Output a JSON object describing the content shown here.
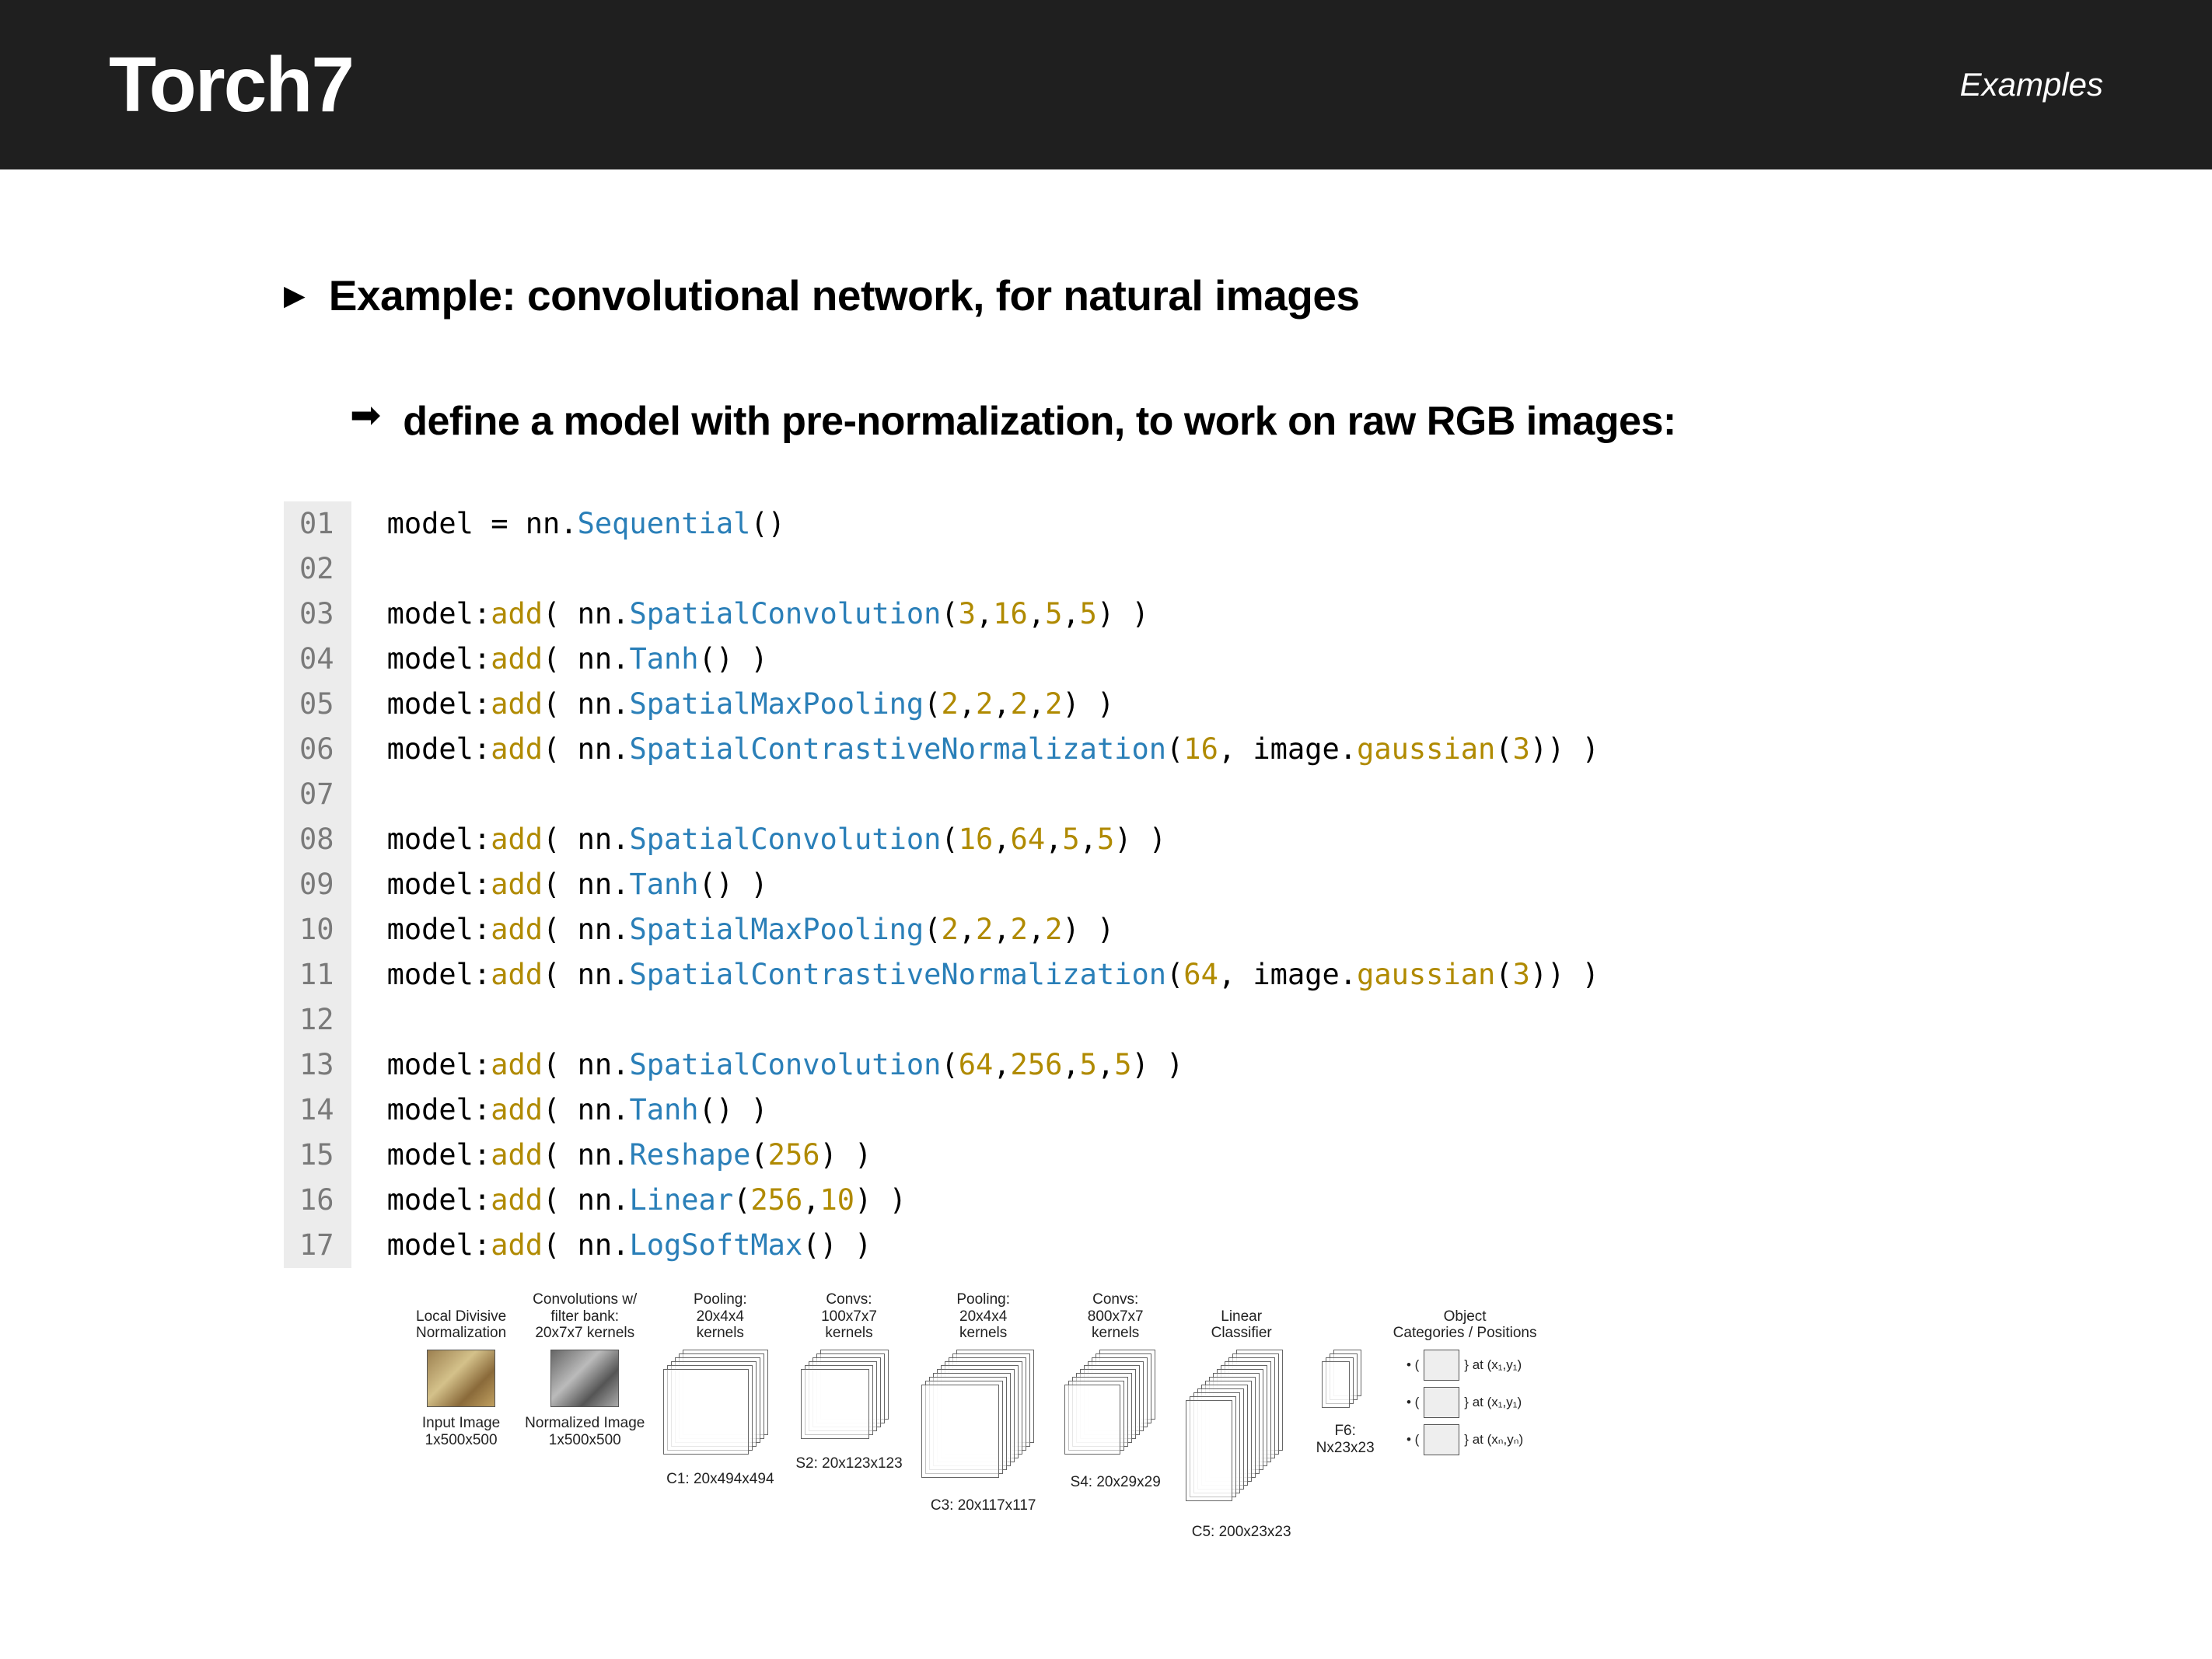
{
  "header": {
    "title": "Torch7",
    "subtitle": "Examples"
  },
  "section": {
    "title": "Example: convolutional network, for natural images",
    "subtitle": "define a model with pre-normalization, to work on raw RGB images:"
  },
  "code": {
    "lines": [
      {
        "n": "01",
        "t": [
          {
            "p": "model "
          },
          {
            "p": "="
          },
          {
            "p": " nn"
          },
          {
            "p": ".",
            "c": ""
          },
          {
            "p": "Sequential",
            "c": "fn"
          },
          {
            "p": "()"
          }
        ]
      },
      {
        "n": "02",
        "t": []
      },
      {
        "n": "03",
        "t": [
          {
            "p": "model"
          },
          {
            "p": ":"
          },
          {
            "p": "add",
            "c": "method"
          },
          {
            "p": "( nn."
          },
          {
            "p": "SpatialConvolution",
            "c": "fn"
          },
          {
            "p": "("
          },
          {
            "p": "3",
            "c": "num"
          },
          {
            "p": ","
          },
          {
            "p": "16",
            "c": "num"
          },
          {
            "p": ","
          },
          {
            "p": "5",
            "c": "num"
          },
          {
            "p": ","
          },
          {
            "p": "5",
            "c": "num"
          },
          {
            "p": ") )"
          }
        ]
      },
      {
        "n": "04",
        "t": [
          {
            "p": "model"
          },
          {
            "p": ":"
          },
          {
            "p": "add",
            "c": "method"
          },
          {
            "p": "( nn."
          },
          {
            "p": "Tanh",
            "c": "fn"
          },
          {
            "p": "() )"
          }
        ]
      },
      {
        "n": "05",
        "t": [
          {
            "p": "model"
          },
          {
            "p": ":"
          },
          {
            "p": "add",
            "c": "method"
          },
          {
            "p": "( nn."
          },
          {
            "p": "SpatialMaxPooling",
            "c": "fn"
          },
          {
            "p": "("
          },
          {
            "p": "2",
            "c": "num"
          },
          {
            "p": ","
          },
          {
            "p": "2",
            "c": "num"
          },
          {
            "p": ","
          },
          {
            "p": "2",
            "c": "num"
          },
          {
            "p": ","
          },
          {
            "p": "2",
            "c": "num"
          },
          {
            "p": ") )"
          }
        ]
      },
      {
        "n": "06",
        "t": [
          {
            "p": "model"
          },
          {
            "p": ":"
          },
          {
            "p": "add",
            "c": "method"
          },
          {
            "p": "( nn."
          },
          {
            "p": "SpatialContrastiveNormalization",
            "c": "fn"
          },
          {
            "p": "("
          },
          {
            "p": "16",
            "c": "num"
          },
          {
            "p": ", image."
          },
          {
            "p": "gaussian",
            "c": "method"
          },
          {
            "p": "("
          },
          {
            "p": "3",
            "c": "num"
          },
          {
            "p": ")) )"
          }
        ]
      },
      {
        "n": "07",
        "t": []
      },
      {
        "n": "08",
        "t": [
          {
            "p": "model"
          },
          {
            "p": ":"
          },
          {
            "p": "add",
            "c": "method"
          },
          {
            "p": "( nn."
          },
          {
            "p": "SpatialConvolution",
            "c": "fn"
          },
          {
            "p": "("
          },
          {
            "p": "16",
            "c": "num"
          },
          {
            "p": ","
          },
          {
            "p": "64",
            "c": "num"
          },
          {
            "p": ","
          },
          {
            "p": "5",
            "c": "num"
          },
          {
            "p": ","
          },
          {
            "p": "5",
            "c": "num"
          },
          {
            "p": ") )"
          }
        ]
      },
      {
        "n": "09",
        "t": [
          {
            "p": "model"
          },
          {
            "p": ":"
          },
          {
            "p": "add",
            "c": "method"
          },
          {
            "p": "( nn."
          },
          {
            "p": "Tanh",
            "c": "fn"
          },
          {
            "p": "() )"
          }
        ]
      },
      {
        "n": "10",
        "t": [
          {
            "p": "model"
          },
          {
            "p": ":"
          },
          {
            "p": "add",
            "c": "method"
          },
          {
            "p": "( nn."
          },
          {
            "p": "SpatialMaxPooling",
            "c": "fn"
          },
          {
            "p": "("
          },
          {
            "p": "2",
            "c": "num"
          },
          {
            "p": ","
          },
          {
            "p": "2",
            "c": "num"
          },
          {
            "p": ","
          },
          {
            "p": "2",
            "c": "num"
          },
          {
            "p": ","
          },
          {
            "p": "2",
            "c": "num"
          },
          {
            "p": ") )"
          }
        ]
      },
      {
        "n": "11",
        "t": [
          {
            "p": "model"
          },
          {
            "p": ":"
          },
          {
            "p": "add",
            "c": "method"
          },
          {
            "p": "( nn."
          },
          {
            "p": "SpatialContrastiveNormalization",
            "c": "fn"
          },
          {
            "p": "("
          },
          {
            "p": "64",
            "c": "num"
          },
          {
            "p": ", image."
          },
          {
            "p": "gaussian",
            "c": "method"
          },
          {
            "p": "("
          },
          {
            "p": "3",
            "c": "num"
          },
          {
            "p": ")) )"
          }
        ]
      },
      {
        "n": "12",
        "t": []
      },
      {
        "n": "13",
        "t": [
          {
            "p": "model"
          },
          {
            "p": ":"
          },
          {
            "p": "add",
            "c": "method"
          },
          {
            "p": "( nn."
          },
          {
            "p": "SpatialConvolution",
            "c": "fn"
          },
          {
            "p": "("
          },
          {
            "p": "64",
            "c": "num"
          },
          {
            "p": ","
          },
          {
            "p": "256",
            "c": "num"
          },
          {
            "p": ","
          },
          {
            "p": "5",
            "c": "num"
          },
          {
            "p": ","
          },
          {
            "p": "5",
            "c": "num"
          },
          {
            "p": ") )"
          }
        ]
      },
      {
        "n": "14",
        "t": [
          {
            "p": "model"
          },
          {
            "p": ":"
          },
          {
            "p": "add",
            "c": "method"
          },
          {
            "p": "( nn."
          },
          {
            "p": "Tanh",
            "c": "fn"
          },
          {
            "p": "() )"
          }
        ]
      },
      {
        "n": "15",
        "t": [
          {
            "p": "model"
          },
          {
            "p": ":"
          },
          {
            "p": "add",
            "c": "method"
          },
          {
            "p": "( nn."
          },
          {
            "p": "Reshape",
            "c": "fn"
          },
          {
            "p": "("
          },
          {
            "p": "256",
            "c": "num"
          },
          {
            "p": ") )"
          }
        ]
      },
      {
        "n": "16",
        "t": [
          {
            "p": "model"
          },
          {
            "p": ":"
          },
          {
            "p": "add",
            "c": "method"
          },
          {
            "p": "( nn."
          },
          {
            "p": "Linear",
            "c": "fn"
          },
          {
            "p": "("
          },
          {
            "p": "256",
            "c": "num"
          },
          {
            "p": ","
          },
          {
            "p": "10",
            "c": "num"
          },
          {
            "p": ") )"
          }
        ]
      },
      {
        "n": "17",
        "t": [
          {
            "p": "model"
          },
          {
            "p": ":"
          },
          {
            "p": "add",
            "c": "method"
          },
          {
            "p": "( nn."
          },
          {
            "p": "LogSoftMax",
            "c": "fn"
          },
          {
            "p": "() )"
          }
        ]
      }
    ]
  },
  "diagram": {
    "cols": [
      {
        "top": "Local Divisive\nNormalization",
        "bot": "Input Image\n1x500x500",
        "type": "img"
      },
      {
        "top": "Convolutions w/\nfilter bank:\n20x7x7 kernels",
        "bot": "Normalized Image\n1x500x500",
        "type": "imggray"
      },
      {
        "top": "Pooling:\n20x4x4\nkernels",
        "bot": "C1: 20x494x494",
        "type": "stack",
        "layers": 6,
        "w": 110,
        "h": 110
      },
      {
        "top": "Convs:\n100x7x7\nkernels",
        "bot": "S2: 20x123x123",
        "type": "stack",
        "layers": 6,
        "w": 88,
        "h": 90
      },
      {
        "top": "Pooling:\n20x4x4\nkernels",
        "bot": "C3: 20x117x117",
        "type": "stack",
        "layers": 10,
        "w": 100,
        "h": 120
      },
      {
        "top": "Convs:\n800x7x7\nkernels",
        "bot": "S4: 20x29x29",
        "type": "stack",
        "layers": 10,
        "w": 72,
        "h": 90
      },
      {
        "top": "Linear\nClassifier",
        "bot": "C5: 200x23x23",
        "type": "stack",
        "layers": 14,
        "w": 60,
        "h": 130
      },
      {
        "top": "",
        "bot": "F6:\nNx23x23",
        "type": "stack",
        "layers": 4,
        "w": 36,
        "h": 60
      },
      {
        "top": "Object\nCategories / Positions",
        "bot": "",
        "type": "out"
      }
    ],
    "outs": [
      {
        "suffix": "} at (x₁,y₁)"
      },
      {
        "suffix": "} at (x₁,y₁)"
      },
      {
        "suffix": "} at (xₙ,yₙ)"
      }
    ]
  }
}
